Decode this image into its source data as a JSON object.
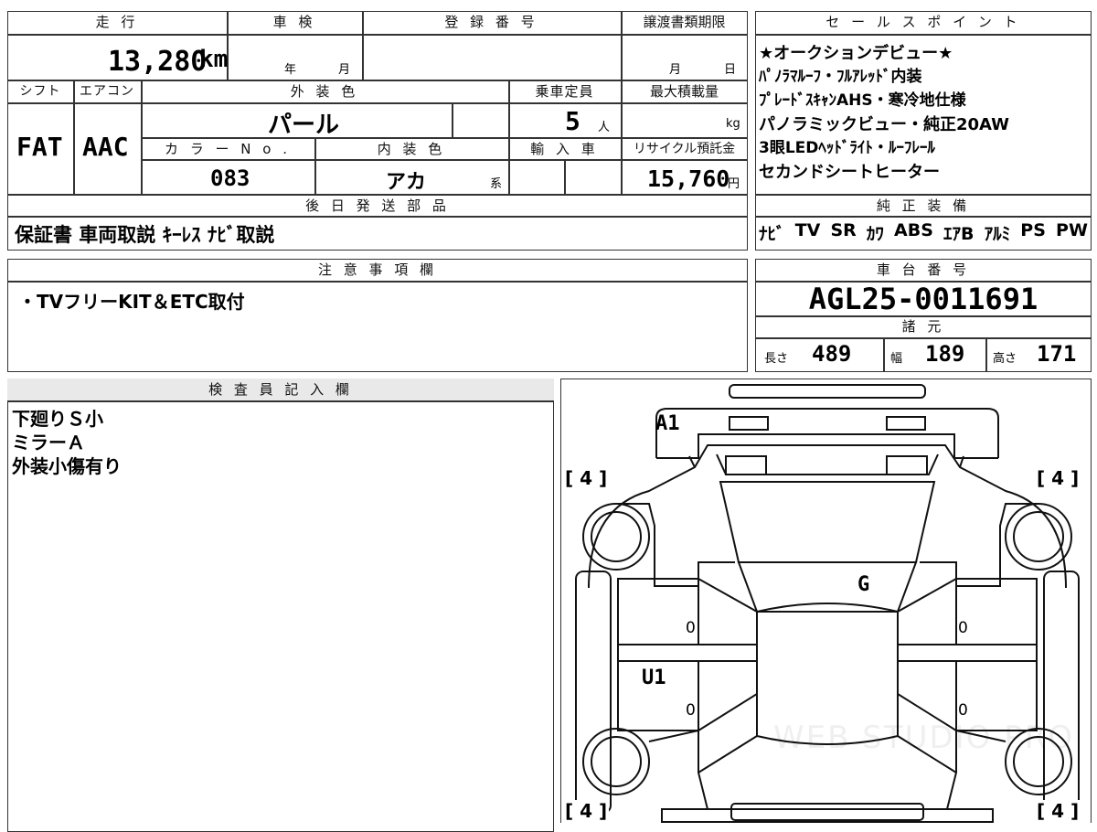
{
  "top_table": {
    "mileage_header": "走 行",
    "mileage_value": "13,280",
    "mileage_unit": "km",
    "inspection_header": "車 検",
    "inspection_year_label": "年",
    "inspection_month_label": "月",
    "registration_header": "登 録 番 号",
    "transfer_header": "譲渡書類期限",
    "transfer_month_label": "月",
    "transfer_day_label": "日",
    "shift_header": "シフト",
    "aircon_header": "エアコン",
    "exterior_color_header": "外 装 色",
    "capacity_header": "乗車定員",
    "max_load_header": "最大積載量",
    "shift_value": "FAT",
    "aircon_value": "AAC",
    "exterior_color_value": "パール",
    "capacity_value": "5",
    "capacity_unit": "人",
    "max_load_unit": "kg",
    "color_no_header": "カ ラ ー N o .",
    "interior_color_header": "内 装 色",
    "import_header": "輸 入 車",
    "recycle_header": "リサイクル預託金",
    "color_no_value": "083",
    "interior_color_value": "アカ",
    "interior_color_suffix": "系",
    "recycle_value": "15,760",
    "recycle_unit": "円",
    "later_parts_header": "後 日 発 送 部 品",
    "later_parts_value": "保証書 車両取説 ｷｰﾚｽ ﾅﾋﾞ取説"
  },
  "sales_points": {
    "header": "セ ー ル ス ポ イ ン ト",
    "lines": [
      "★オークションデビュー★",
      "ﾊﾟﾉﾗﾏﾙｰﾌ・ﾌﾙｱﾚｯﾄﾞ内装",
      "ﾌﾟﾚｰﾄﾞｽｷｬﾝAHS・寒冷地仕様",
      "パノラミックビュー・純正20AW",
      "3眼LEDﾍｯﾄﾞﾗｲﾄ・ﾙｰﾌﾚｰﾙ",
      "セカンドシートヒーター"
    ]
  },
  "equipment": {
    "header": "純 正 装 備",
    "items": [
      "ﾅﾋﾞ",
      "TV",
      "SR",
      "ｶﾜ",
      "ABS",
      "ｴｱB",
      "ｱﾙﾐ",
      "PS",
      "PW"
    ]
  },
  "notes": {
    "header": "注 意 事 項 欄",
    "value": "・TVフリーKIT＆ETC取付"
  },
  "chassis": {
    "header": "車 台 番 号",
    "value": "AGL25-0011691",
    "specs_header": "諸 元",
    "length_label": "長さ",
    "length_value": "489",
    "width_label": "幅",
    "width_value": "189",
    "height_label": "高さ",
    "height_value": "171"
  },
  "inspector": {
    "header": "検 査 員 記 入 欄",
    "lines": [
      "下廻りＳ小",
      "ミラーＡ",
      "外装小傷有り"
    ]
  },
  "diagram": {
    "marks": {
      "a1": "A1",
      "g": "G",
      "u1": "U1",
      "zero_left_1": "0",
      "zero_left_2": "0",
      "zero_right_1": "0",
      "zero_right_2": "0"
    },
    "tire_labels": [
      "[ 4 ]",
      "[ 4 ]",
      "[ 4 ]",
      "[ 4 ]"
    ],
    "watermark": "WEB STUDIO PRO"
  }
}
